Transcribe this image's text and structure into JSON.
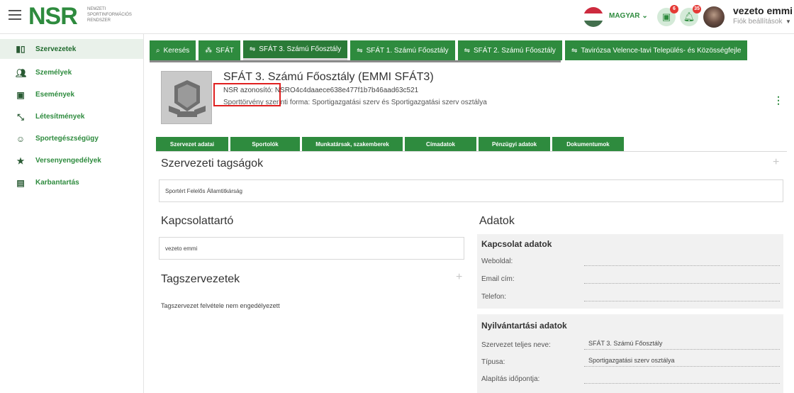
{
  "header": {
    "logo_text": "NSR",
    "logo_subtitle_lines": [
      "NEMZETI",
      "SPORTINFORMÁCIÓS",
      "RENDSZER"
    ],
    "language_label": "MAGYAR",
    "tasks_badge": "6",
    "notifications_badge": "35",
    "user_name": "vezeto emmi",
    "account_link": "Fiók beállítások"
  },
  "sidebar": {
    "items": [
      {
        "label": "Szervezetek",
        "icon": "building-icon"
      },
      {
        "label": "Személyek",
        "icon": "people-icon"
      },
      {
        "label": "Események",
        "icon": "calendar-icon"
      },
      {
        "label": "Létesítmények",
        "icon": "arrows-icon"
      },
      {
        "label": "Sportegészségügy",
        "icon": "smile-icon"
      },
      {
        "label": "Versenyengedélyek",
        "icon": "star-icon"
      },
      {
        "label": "Karbantartás",
        "icon": "clipboard-icon"
      }
    ]
  },
  "tabs": [
    {
      "label": "Keresés",
      "icon": "search-icon"
    },
    {
      "label": "SFÁT",
      "icon": "sitemap-icon"
    },
    {
      "label": "SFÁT 3. Számú Főosztály",
      "icon": "handshake-icon"
    },
    {
      "label": "SFÁT 1. Számú Főosztály",
      "icon": "handshake-icon"
    },
    {
      "label": "SFÁT 2. Számú Főosztály",
      "icon": "handshake-icon"
    },
    {
      "label": "Tavirózsa Velence-tavi Település- és Közösségfejle",
      "icon": "handshake-icon"
    }
  ],
  "org": {
    "name": "SFÁT 3. Számú Főosztály (EMMI SFÁT3)",
    "nsr_label": "NSR azonosító:",
    "nsr_id": "NSRO4c4daaece638e477f1b7b46aad63c521",
    "legal_form": "Sporttörvény szerinti forma: Sportigazgatási szerv és Sportigazgatási szerv osztálya"
  },
  "subtabs": [
    "Szervezet adatai",
    "Sportolók",
    "Munkatársak, szakemberek",
    "Címadatok",
    "Pénzügyi adatok",
    "Dokumentumok"
  ],
  "membership": {
    "title": "Szervezeti tagságok",
    "item": "Sportért Felelős Államtitkárság"
  },
  "contact": {
    "title": "Kapcsolattartó",
    "item": "vezeto emmi"
  },
  "members": {
    "title": "Tagszervezetek",
    "note": "Tagszervezet felvétele nem engedélyezett"
  },
  "data_panel": {
    "title": "Adatok",
    "contact_card": {
      "title": "Kapcsolat adatok",
      "rows": [
        {
          "label": "Weboldal:",
          "value": ""
        },
        {
          "label": "Email cím:",
          "value": ""
        },
        {
          "label": "Telefon:",
          "value": ""
        }
      ]
    },
    "registry_card": {
      "title": "Nyilvántartási adatok",
      "rows": [
        {
          "label": "Szervezet teljes neve:",
          "value": "SFÁT 3. Számú Főosztály"
        },
        {
          "label": "Típusa:",
          "value": "Sportigazgatási szerv osztálya"
        },
        {
          "label": "Alapítás időpontja:",
          "value": ""
        }
      ]
    }
  },
  "colors": {
    "brand_green": "#2e8b3e",
    "highlight_red": "#e02020"
  }
}
